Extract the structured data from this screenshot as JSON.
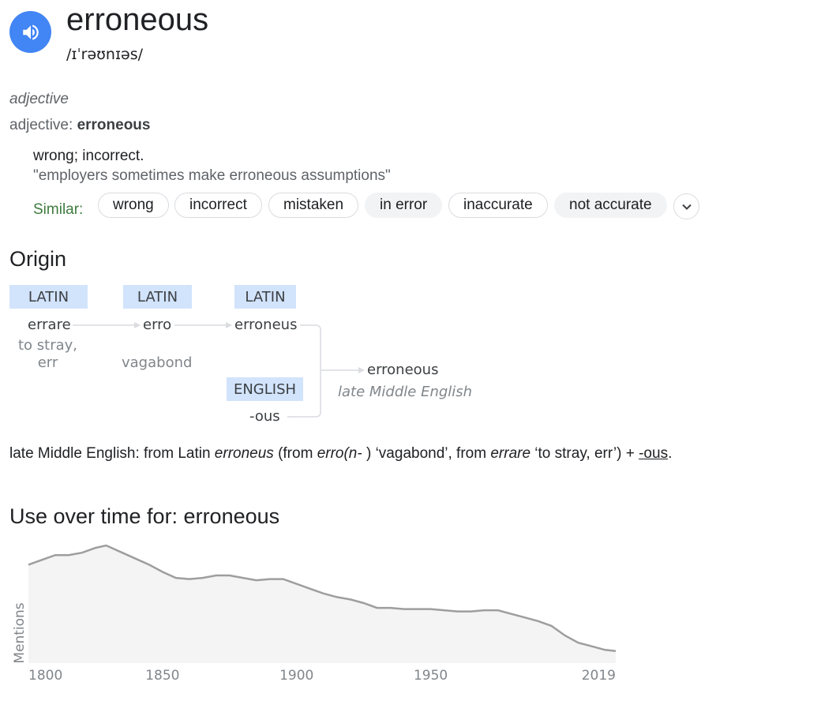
{
  "header": {
    "word": "erroneous",
    "phonetic": "/ɪˈrəʊnɪəs/",
    "speaker_icon": "volume-icon"
  },
  "sense": {
    "part_of_speech": "adjective",
    "pos_label": "adjective",
    "pos_word": "erroneous",
    "definition": "wrong; incorrect.",
    "example": "\"employers sometimes make erroneous assumptions\"",
    "similar_label": "Similar:",
    "similar": [
      "wrong",
      "incorrect",
      "mistaken",
      "in error",
      "inaccurate",
      "not accurate"
    ]
  },
  "origin": {
    "heading": "Origin",
    "languages": [
      "LATIN",
      "LATIN",
      "LATIN",
      "ENGLISH"
    ],
    "words": [
      "errare",
      "erro",
      "erroneus",
      "-ous",
      "erroneous"
    ],
    "glosses": [
      "to stray,",
      "err",
      "vagabond"
    ],
    "result_note": "late Middle English",
    "text": {
      "p1": "late Middle English: from Latin ",
      "i1": "erroneus",
      "p2": " (from ",
      "i2": "erro(n-",
      "p3": " ) ‘vagabond’, from ",
      "i3": "errare",
      "p4": " ‘to stray, err’) + ",
      "link": "-ous",
      "p5": "."
    }
  },
  "usage": {
    "heading": "Use over time for: erroneous"
  },
  "chart_data": {
    "type": "area",
    "title": "",
    "xlabel": "",
    "ylabel": "Mentions",
    "x_ticks": [
      "1800",
      "1850",
      "1900",
      "1950",
      "2019"
    ],
    "xlim": [
      1800,
      2019
    ],
    "ylim": [
      0,
      100
    ],
    "y_scale_note": "relative (no y tick labels shown)",
    "series": [
      {
        "x": [
          1800,
          1805,
          1810,
          1815,
          1820,
          1825,
          1829,
          1832,
          1835,
          1840,
          1845,
          1850,
          1855,
          1860,
          1865,
          1870,
          1875,
          1880,
          1885,
          1890,
          1895,
          1900,
          1905,
          1910,
          1915,
          1920,
          1925,
          1930,
          1935,
          1940,
          1945,
          1950,
          1955,
          1960,
          1965,
          1970,
          1975,
          1980,
          1985,
          1990,
          1995,
          2000,
          2005,
          2010,
          2015,
          2019
        ],
        "values": [
          82,
          86,
          90,
          90,
          92,
          96,
          98,
          95,
          92,
          87,
          82,
          76,
          71,
          70,
          71,
          73,
          73,
          71,
          69,
          70,
          70,
          66,
          62,
          58,
          55,
          53,
          50,
          46,
          46,
          45,
          45,
          45,
          44,
          43,
          43,
          44,
          44,
          41,
          38,
          35,
          31,
          23,
          17,
          14,
          11,
          10
        ]
      }
    ],
    "colors": {
      "line": "#9e9e9e",
      "fill": "#f4f4f4"
    }
  },
  "colors": {
    "accent": "#4285f4",
    "lang_tag": "#d2e3fc",
    "similar_label": "#3e7b3e"
  }
}
